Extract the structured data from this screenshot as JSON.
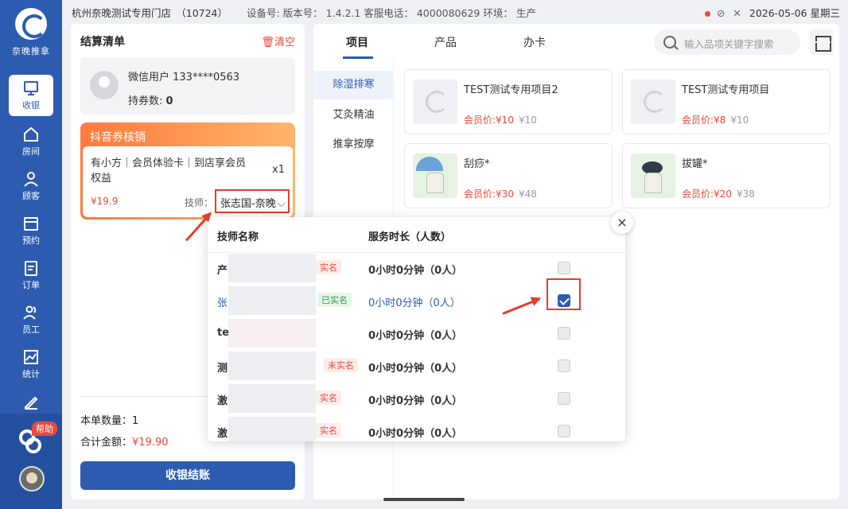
{
  "app": {
    "logo_text": "奈晚推拿"
  },
  "topbar": {
    "store": "杭州奈晚测试专用门店　（10724）",
    "device_info": "设备号:  版本号：  1.4.2.1   客服电话：  4000080629   环境：  生产",
    "datetime": "2026-05-06 星期三"
  },
  "sidebar": {
    "items": [
      {
        "label": "收银",
        "icon": "cashier-icon",
        "active": true
      },
      {
        "label": "房间",
        "icon": "home-icon"
      },
      {
        "label": "顾客",
        "icon": "user-icon"
      },
      {
        "label": "预约",
        "icon": "calendar-icon"
      },
      {
        "label": "订单",
        "icon": "order-icon"
      },
      {
        "label": "员工",
        "icon": "staff-icon"
      },
      {
        "label": "统计",
        "icon": "chart-icon"
      },
      {
        "label": "",
        "icon": "pen-icon"
      }
    ],
    "help_badge": "帮助"
  },
  "cart": {
    "title": "结算清单",
    "clear_label": "清空",
    "member": {
      "name": "微信用户 133****0563",
      "coupons_label": "持券数: ",
      "coupons_value": "0"
    },
    "coupon": {
      "title": "抖音券核销",
      "desc": "有小方｜会员体验卡｜到店享会员权益",
      "qty": "x1",
      "price": "¥19.9",
      "tech_label": "技师：",
      "tech_value": "张志国-奈晚"
    },
    "count_label": "本单数量：",
    "count_value": "1",
    "total_label": "合计金额：",
    "total_value": "¥19.90",
    "checkout_label": "收银结账"
  },
  "main": {
    "tabs": [
      "项目",
      "产品",
      "办卡"
    ],
    "active_tab": 0,
    "search_placeholder": "输入品项关键字搜索",
    "categories": [
      "除湿排寒",
      "艾灸精油",
      "推拿按摩"
    ],
    "active_category": 0,
    "items": [
      {
        "name": "TEST测试专用项目2",
        "member_price": "会员价:¥10",
        "orig_price": "¥10",
        "thumb": "moon"
      },
      {
        "name": "TEST测试专用项目",
        "member_price": "会员价:¥8",
        "orig_price": "¥10",
        "thumb": "moon"
      },
      {
        "name": "刮痧*",
        "member_price": "会员价:¥30",
        "orig_price": "¥48",
        "thumb": "umbrella"
      },
      {
        "name": "拔罐*",
        "member_price": "会员价:¥20",
        "orig_price": "¥38",
        "thumb": "art"
      }
    ]
  },
  "popup": {
    "col_name": "技师名称",
    "col_duration": "服务时长（人数）",
    "close_label": "×",
    "rows": [
      {
        "name": "产",
        "tag": "实名",
        "tag_type": "red",
        "duration": "0小时0分钟（0人）",
        "checked": false
      },
      {
        "name": "张",
        "tag": "已实名",
        "tag_type": "green",
        "duration": "0小时0分钟（0人）",
        "checked": true
      },
      {
        "name": "te",
        "tag": "",
        "tag_type": "",
        "duration": "0小时0分钟（0人）",
        "checked": false
      },
      {
        "name": "测",
        "tag": "未实名",
        "tag_type": "red",
        "duration": "0小时0分钟（0人）",
        "checked": false
      },
      {
        "name": "激",
        "tag": "实名",
        "tag_type": "red",
        "duration": "0小时0分钟（0人）",
        "checked": false
      },
      {
        "name": "激",
        "tag": "实名",
        "tag_type": "red",
        "duration": "0小时0分钟（0人）",
        "checked": false
      }
    ]
  }
}
